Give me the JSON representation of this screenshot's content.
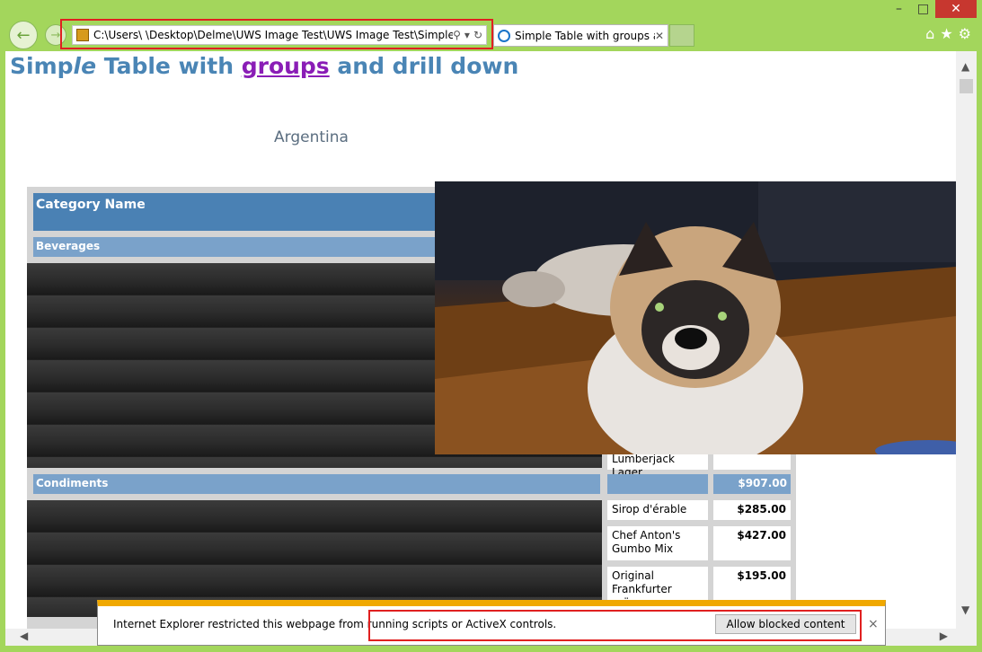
{
  "window": {
    "minimize": "–",
    "maximize": "□",
    "close": "✕"
  },
  "nav": {
    "back_icon": "←",
    "forward_icon": "→"
  },
  "address_bar": {
    "url": "C:\\Users\\        \\Desktop\\Delme\\UWS Image Test\\UWS Image Test\\Simple",
    "search_icon": "⚲",
    "dropdown_icon": "▾",
    "refresh_icon": "↻"
  },
  "tab": {
    "label": "Simple Table with groups a...",
    "close": "✕"
  },
  "tools": {
    "home_icon": "⌂",
    "favorites_icon": "★",
    "settings_icon": "⚙"
  },
  "page": {
    "title_part1": "Simp",
    "title_part2": "le",
    "title_part3": " Table with ",
    "title_link": "groups",
    "title_part4": " and drill down",
    "country": "Argentina",
    "category_header": "Category Name",
    "groups": [
      {
        "name": "Beverages",
        "total": ""
      },
      {
        "name": "Condiments",
        "total": "$907.00"
      }
    ],
    "rows": [
      {
        "product": "Lumberjack Lager",
        "amount": ""
      },
      {
        "product": "Sirop d'érable",
        "amount": "$285.00"
      },
      {
        "product": "Chef Anton's Gumbo Mix",
        "amount": "$427.00"
      },
      {
        "product": "Original Frankfurter grüne",
        "amount": "$195.00"
      }
    ]
  },
  "notification": {
    "message": "Internet Explorer restricted this webpage from running scripts or ActiveX controls.",
    "button": "Allow blocked content",
    "close": "×"
  },
  "scroll": {
    "up": "▲",
    "down": "▼",
    "left": "◀",
    "right": "▶"
  }
}
